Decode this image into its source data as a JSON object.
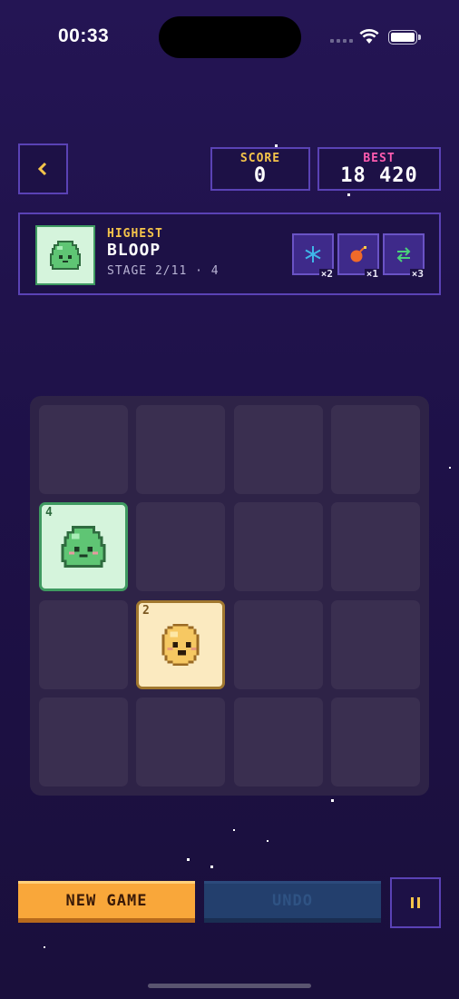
{
  "status_bar": {
    "time": "00:33"
  },
  "header": {
    "score_label": "SCORE",
    "score_value": "0",
    "best_label": "BEST",
    "best_value": "18 420"
  },
  "highest": {
    "kicker": "HIGHEST",
    "name": "BLOOP",
    "stage": "STAGE 2/11 · 4",
    "powerups": [
      {
        "icon": "snowflake-icon",
        "count": "×2",
        "color": "#3fb6e8"
      },
      {
        "icon": "bomb-icon",
        "count": "×1",
        "color": "#f06a2a"
      },
      {
        "icon": "swap-icon",
        "count": "×3",
        "color": "#4ad07a"
      }
    ]
  },
  "board": {
    "tiles": [
      {
        "value": "4",
        "creature": "green-slime",
        "row": 2,
        "col": 1
      },
      {
        "value": "2",
        "creature": "yellow-blob",
        "row": 3,
        "col": 2
      }
    ]
  },
  "controls": {
    "new_game_label": "NEW GAME",
    "undo_label": "UNDO"
  },
  "colors": {
    "accent": "#5a42b5",
    "gold": "#f5c44a",
    "best": "#ff5cb0",
    "new_game": "#f9a73a"
  }
}
